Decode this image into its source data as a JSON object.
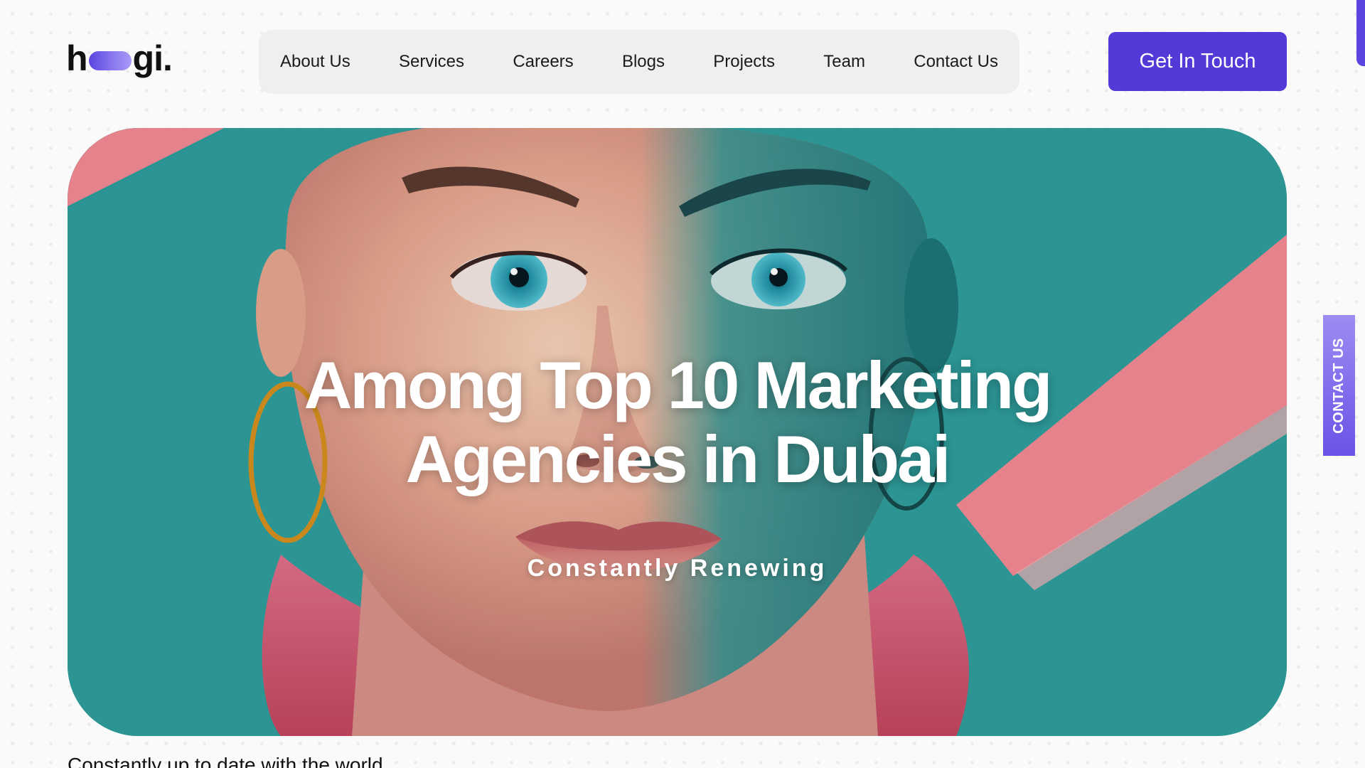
{
  "brand": {
    "logo_left": "h",
    "logo_right": "gi.",
    "accent_color": "#5339d8"
  },
  "nav": {
    "items": [
      {
        "label": "About Us"
      },
      {
        "label": "Services"
      },
      {
        "label": "Careers"
      },
      {
        "label": "Blogs"
      },
      {
        "label": "Projects"
      },
      {
        "label": "Team"
      },
      {
        "label": "Contact Us"
      }
    ]
  },
  "header": {
    "cta_label": "Get In Touch"
  },
  "hero": {
    "title_line1": "Among Top 10 Marketing",
    "title_line2": "Agencies in Dubai",
    "subtitle": "Constantly Renewing",
    "image_subject": "portrait-illustration",
    "colors": {
      "teal": "#2d9d9c",
      "pink": "#f48b95"
    }
  },
  "side_tab": {
    "label": "CONTACT US"
  },
  "section": {
    "tagline": "Constantly up to date with the world"
  }
}
